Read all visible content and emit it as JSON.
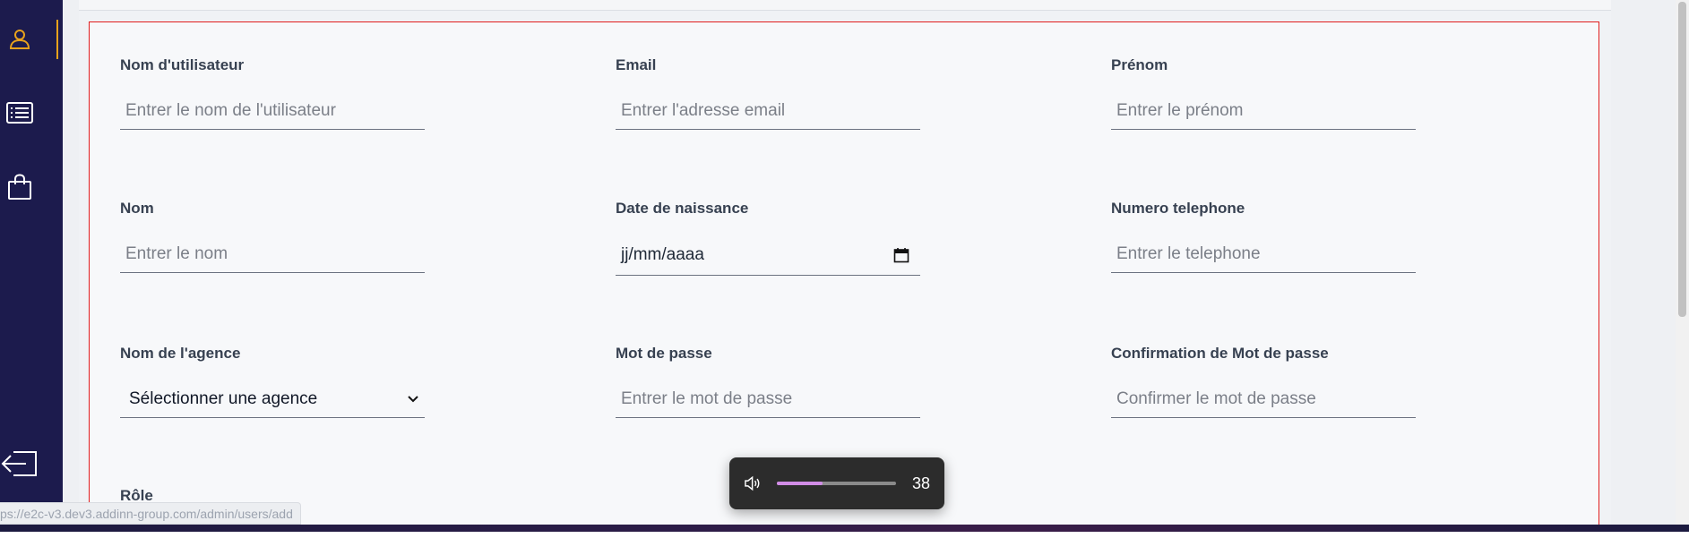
{
  "form": {
    "fields": [
      {
        "label": "Nom d'utilisateur",
        "placeholder": "Entrer le nom de l'utilisateur"
      },
      {
        "label": "Email",
        "placeholder": "Entrer l'adresse email"
      },
      {
        "label": "Prénom",
        "placeholder": "Entrer le prénom"
      },
      {
        "label": "Nom",
        "placeholder": "Entrer le nom"
      },
      {
        "label": "Date de naissance",
        "value": "jj/mm/aaaa"
      },
      {
        "label": "Numero telephone",
        "placeholder": "Entrer le telephone"
      },
      {
        "label": "Nom de l'agence",
        "selected": "Sélectionner une agence"
      },
      {
        "label": "Mot de passe",
        "placeholder": "Entrer le mot de passe"
      },
      {
        "label": "Confirmation de Mot de passe",
        "placeholder": "Confirmer le mot de passe"
      }
    ],
    "role_label": "Rôle"
  },
  "sidebar": {
    "items": [
      {
        "icon": "user-icon",
        "active": true
      },
      {
        "icon": "list-icon",
        "active": false
      },
      {
        "icon": "shopping-bag-icon",
        "active": false
      },
      {
        "icon": "logout-icon",
        "active": false
      }
    ],
    "accent_color": "#e8a21c",
    "background_color": "#1c1b4d"
  },
  "status_bar": {
    "url": "ps://e2c-v3.dev3.addinn-group.com/admin/users/add"
  },
  "volume": {
    "icon": "speaker-icon",
    "level": 38,
    "fill_fraction": 0.38
  },
  "colors": {
    "highlight_border": "#e11d1d"
  }
}
